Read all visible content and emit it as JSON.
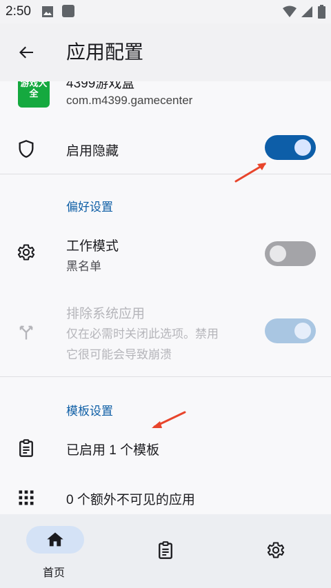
{
  "status_bar": {
    "time": "2:50",
    "icons": [
      "image-icon",
      "app-square-icon",
      "wifi-icon",
      "signal-icon",
      "battery-icon"
    ]
  },
  "app_bar": {
    "title": "应用配置"
  },
  "app_info": {
    "name": "4399游戏盒",
    "package": "com.m4399.gamecenter",
    "icon_text": "游戏大全"
  },
  "enable_hide": {
    "label": "启用隐藏",
    "enabled": true
  },
  "preferences": {
    "section_title": "偏好设置",
    "work_mode": {
      "label": "工作模式",
      "value": "黑名单",
      "enabled": false
    },
    "exclude_system": {
      "label": "排除系统应用",
      "description_line1": "仅在必需时关闭此选项。禁用",
      "description_line2": "它很可能会导致崩溃",
      "enabled": true,
      "disabled": true
    }
  },
  "templates": {
    "section_title": "模板设置",
    "enabled_templates": "已启用 1 个模板",
    "extra_invisible": "0 个额外不可见的应用"
  },
  "bottom_nav": {
    "home_label": "首页"
  },
  "colors": {
    "accent": "#0d5ea8",
    "section_title": "#0f5fa6",
    "annotation_arrow": "#e8452c"
  }
}
